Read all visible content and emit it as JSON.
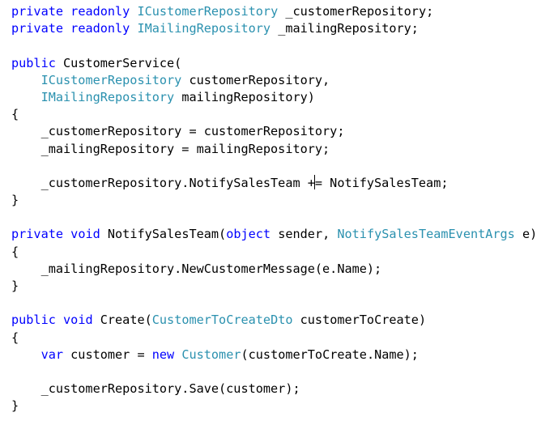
{
  "colors": {
    "background": "#ffffff",
    "plain": "#000000",
    "keyword": "#0000ff",
    "type": "#2b91af"
  },
  "caret_position": {
    "line": 11,
    "after_text": "_customerRepository.NotifySalesTeam +"
  },
  "lines": [
    [
      {
        "t": "kw",
        "v": "private"
      },
      {
        "t": "plain",
        "v": " "
      },
      {
        "t": "kw",
        "v": "readonly"
      },
      {
        "t": "plain",
        "v": " "
      },
      {
        "t": "type",
        "v": "ICustomerRepository"
      },
      {
        "t": "plain",
        "v": " _customerRepository;"
      }
    ],
    [
      {
        "t": "kw",
        "v": "private"
      },
      {
        "t": "plain",
        "v": " "
      },
      {
        "t": "kw",
        "v": "readonly"
      },
      {
        "t": "plain",
        "v": " "
      },
      {
        "t": "type",
        "v": "IMailingRepository"
      },
      {
        "t": "plain",
        "v": " _mailingRepository;"
      }
    ],
    [],
    [
      {
        "t": "kw",
        "v": "public"
      },
      {
        "t": "plain",
        "v": " CustomerService("
      }
    ],
    [
      {
        "t": "plain",
        "v": "    "
      },
      {
        "t": "type",
        "v": "ICustomerRepository"
      },
      {
        "t": "plain",
        "v": " customerRepository,"
      }
    ],
    [
      {
        "t": "plain",
        "v": "    "
      },
      {
        "t": "type",
        "v": "IMailingRepository"
      },
      {
        "t": "plain",
        "v": " mailingRepository)"
      }
    ],
    [
      {
        "t": "plain",
        "v": "{"
      }
    ],
    [
      {
        "t": "plain",
        "v": "    _customerRepository = customerRepository;"
      }
    ],
    [
      {
        "t": "plain",
        "v": "    _mailingRepository = mailingRepository;"
      }
    ],
    [],
    [
      {
        "t": "plain",
        "v": "    _customerRepository.NotifySalesTeam +"
      },
      {
        "t": "caret",
        "v": ""
      },
      {
        "t": "plain",
        "v": "= NotifySalesTeam;"
      }
    ],
    [
      {
        "t": "plain",
        "v": "}"
      }
    ],
    [],
    [
      {
        "t": "kw",
        "v": "private"
      },
      {
        "t": "plain",
        "v": " "
      },
      {
        "t": "kw",
        "v": "void"
      },
      {
        "t": "plain",
        "v": " NotifySalesTeam("
      },
      {
        "t": "kw",
        "v": "object"
      },
      {
        "t": "plain",
        "v": " sender, "
      },
      {
        "t": "type",
        "v": "NotifySalesTeamEventArgs"
      },
      {
        "t": "plain",
        "v": " e)"
      }
    ],
    [
      {
        "t": "plain",
        "v": "{"
      }
    ],
    [
      {
        "t": "plain",
        "v": "    _mailingRepository.NewCustomerMessage(e.Name);"
      }
    ],
    [
      {
        "t": "plain",
        "v": "}"
      }
    ],
    [],
    [
      {
        "t": "kw",
        "v": "public"
      },
      {
        "t": "plain",
        "v": " "
      },
      {
        "t": "kw",
        "v": "void"
      },
      {
        "t": "plain",
        "v": " Create("
      },
      {
        "t": "type",
        "v": "CustomerToCreateDto"
      },
      {
        "t": "plain",
        "v": " customerToCreate)"
      }
    ],
    [
      {
        "t": "plain",
        "v": "{"
      }
    ],
    [
      {
        "t": "plain",
        "v": "    "
      },
      {
        "t": "kw",
        "v": "var"
      },
      {
        "t": "plain",
        "v": " customer = "
      },
      {
        "t": "kw",
        "v": "new"
      },
      {
        "t": "plain",
        "v": " "
      },
      {
        "t": "type",
        "v": "Customer"
      },
      {
        "t": "plain",
        "v": "(customerToCreate.Name);"
      }
    ],
    [],
    [
      {
        "t": "plain",
        "v": "    _customerRepository.Save(customer);"
      }
    ],
    [
      {
        "t": "plain",
        "v": "}"
      }
    ]
  ]
}
